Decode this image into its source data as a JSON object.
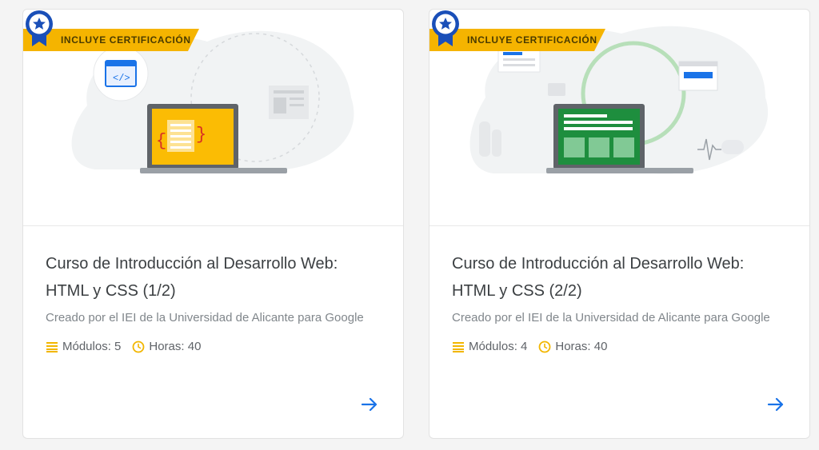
{
  "colors": {
    "ribbon": "#f5b400",
    "badge_blue": "#1a4fb8",
    "arrow_blue": "#1a73e8",
    "meta_icon": "#f2b600"
  },
  "cards": [
    {
      "ribbon": "INCLUYE CERTIFICACIÓN",
      "title_line1": "Curso de Introducción al Desarrollo Web:",
      "title_line2": "HTML y CSS (1/2)",
      "subtitle": "Creado por el IEI de la Universidad de Alicante para Google",
      "modules_label": "Módulos: 5",
      "hours_label": "Horas: 40",
      "icons": [
        "award-badge-icon",
        "list-icon",
        "clock-icon",
        "arrow-right-icon"
      ]
    },
    {
      "ribbon": "INCLUYE CERTIFICACIÓN",
      "title_line1": "Curso de Introducción al Desarrollo Web:",
      "title_line2": "HTML y CSS (2/2)",
      "subtitle": "Creado por el IEI de la Universidad de Alicante para Google",
      "modules_label": "Módulos: 4",
      "hours_label": "Horas: 40",
      "icons": [
        "award-badge-icon",
        "list-icon",
        "clock-icon",
        "arrow-right-icon"
      ]
    }
  ]
}
